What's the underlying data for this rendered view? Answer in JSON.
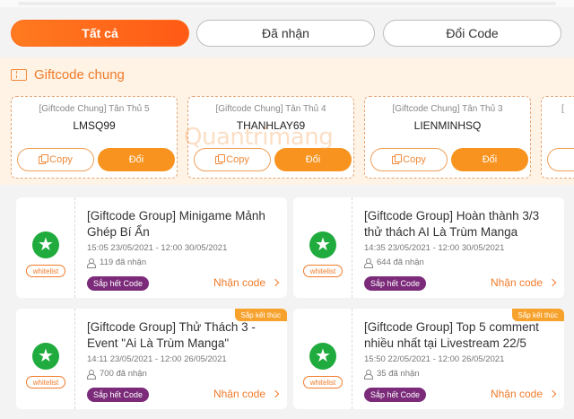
{
  "tabs": [
    {
      "label": "Tất cả",
      "active": true
    },
    {
      "label": "Đã nhận",
      "active": false
    },
    {
      "label": "Đổi Code",
      "active": false
    }
  ],
  "giftcode_section": {
    "title": "Giftcode chung",
    "copy_label": "Copy",
    "redeem_label": "Đổi",
    "cards": [
      {
        "subtitle": "[Giftcode Chung] Tân Thủ 5",
        "code": "LMSQ99"
      },
      {
        "subtitle": "[Giftcode Chung] Tân Thủ 4",
        "code": "THANHLAY69"
      },
      {
        "subtitle": "[Giftcode Chung] Tân Thủ 3",
        "code": "LIENMINHSQ"
      },
      {
        "subtitle": "[",
        "code": ""
      }
    ]
  },
  "watermark": "Quantrimang",
  "events": [
    {
      "title": "[Giftcode Group] Minigame Mảnh Ghép Bí Ẩn",
      "time": "15:05 23/05/2021 - 12:00 30/05/2021",
      "received": "119 đã nhận",
      "status": "Sắp hết Code",
      "claim": "Nhận code",
      "badge": "",
      "whitelist": "whitelist"
    },
    {
      "title": "[Giftcode Group] Hoàn thành 3/3 thử thách AI Là Trùm Manga",
      "time": "14:35 23/05/2021 - 12:00 30/05/2021",
      "received": "644 đã nhận",
      "status": "Sắp hết Code",
      "claim": "Nhận code",
      "badge": "",
      "whitelist": "whitelist"
    },
    {
      "title": "[Giftcode Group] Thử Thách 3 - Event \"Ai Là Trùm Manga\"",
      "time": "14:11 23/05/2021 - 12:00 26/05/2021",
      "received": "700 đã nhận",
      "status": "Sắp hết Code",
      "claim": "Nhận code",
      "badge": "Sắp kết thúc",
      "whitelist": "whitelist"
    },
    {
      "title": "[Giftcode Group] Top 5 comment nhiều nhất tại Livestream 22/5",
      "time": "15:50 22/05/2021 - 12:00 26/05/2021",
      "received": "35 đã nhận",
      "status": "Sắp hết Code",
      "claim": "Nhận code",
      "badge": "Sắp kết thúc",
      "whitelist": "whitelist"
    }
  ],
  "colors": {
    "accent": "#ff6a1a",
    "success": "#1fab3d",
    "status_pill": "#7b2b7a",
    "badge": "#f7a22d"
  }
}
